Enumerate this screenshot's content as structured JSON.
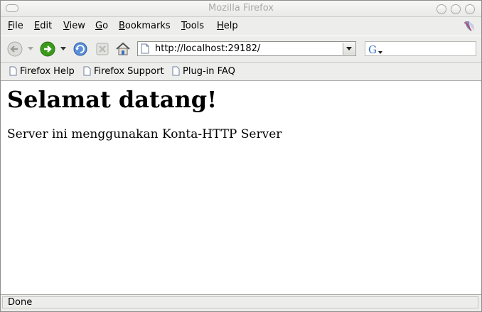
{
  "window": {
    "title": "Mozilla Firefox"
  },
  "menubar": {
    "items": [
      {
        "key": "F",
        "rest": "ile"
      },
      {
        "key": "E",
        "rest": "dit"
      },
      {
        "key": "V",
        "rest": "iew"
      },
      {
        "key": "G",
        "rest": "o"
      },
      {
        "key": "B",
        "rest": "ookmarks"
      },
      {
        "key": "T",
        "rest": "ools"
      },
      {
        "key": "H",
        "rest": "elp"
      }
    ]
  },
  "toolbar": {
    "icons": [
      "back-icon",
      "forward-icon",
      "reload-icon",
      "stop-icon",
      "home-icon"
    ],
    "url": "http://localhost:29182/",
    "search_value": ""
  },
  "bookmarks": {
    "items": [
      "Firefox Help",
      "Firefox Support",
      "Plug-in FAQ"
    ]
  },
  "page": {
    "heading": "Selamat datang!",
    "body": "Server ini menggunakan Konta-HTTP Server"
  },
  "status": {
    "text": "Done"
  },
  "colors": {
    "chrome": "#ededeb",
    "forward_green": "#3a9a1c",
    "link_blue": "#3a6fc4"
  }
}
